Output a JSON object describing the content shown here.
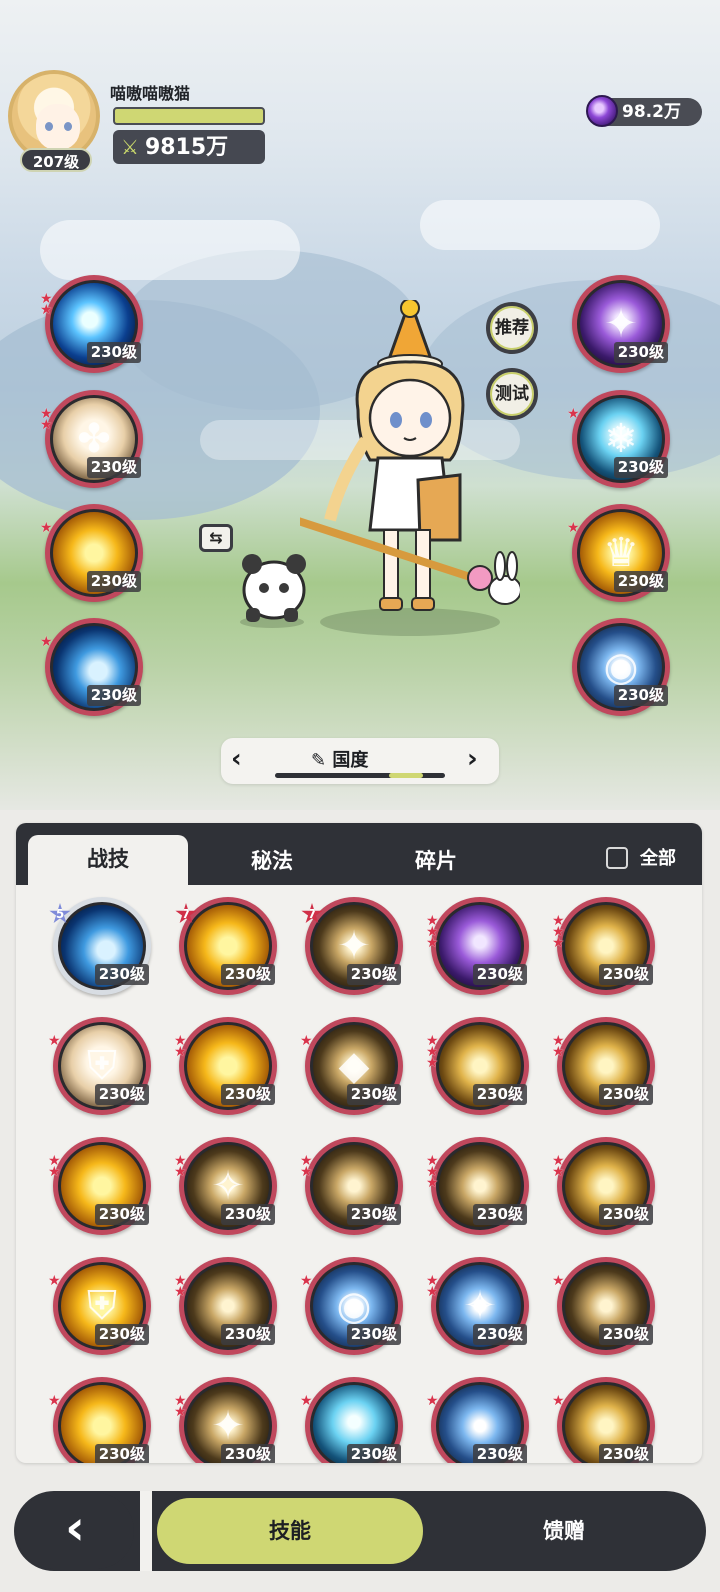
{
  "player": {
    "name": "喵嗷喵嗷猫",
    "level": "207级",
    "power": "9815万"
  },
  "currency": {
    "amount": "98.2万",
    "icon": "purple-gem-icon"
  },
  "side_buttons": {
    "recommend": "推荐",
    "test": "测试"
  },
  "left_skills": [
    {
      "level": "230级",
      "stars": 2,
      "art": "blue-burst"
    },
    {
      "level": "230级",
      "stars": 2,
      "art": "cream-emblem"
    },
    {
      "level": "230级",
      "stars": 1,
      "art": "golden-explosion"
    },
    {
      "level": "230级",
      "stars": 1,
      "art": "blue-wave"
    }
  ],
  "right_skills": [
    {
      "level": "230级",
      "stars": 0,
      "art": "purple-fox"
    },
    {
      "level": "230级",
      "stars": 1,
      "art": "ice-snowflake"
    },
    {
      "level": "230级",
      "stars": 1,
      "art": "golden-crown"
    },
    {
      "level": "230级",
      "stars": 0,
      "art": "blue-orb"
    }
  ],
  "selector": {
    "title": "国度",
    "edit_icon": "pencil-icon",
    "page_fraction": 0.2
  },
  "panel": {
    "tabs": [
      "战技",
      "秘法",
      "碎片"
    ],
    "active_tab": "战技",
    "select_all_label": "全部"
  },
  "grid_skills": [
    {
      "level": "230级",
      "badge": "5",
      "badge_color": "blue",
      "stars": 0,
      "art": "blue-wave"
    },
    {
      "level": "230级",
      "badge": "7",
      "badge_color": "red",
      "stars": 0,
      "art": "golden-burst"
    },
    {
      "level": "230级",
      "badge": "7",
      "badge_color": "red",
      "stars": 0,
      "art": "light-star"
    },
    {
      "level": "230级",
      "badge": "",
      "stars": 3,
      "art": "purple-rings"
    },
    {
      "level": "230级",
      "badge": "",
      "stars": 3,
      "art": "gold-sweep"
    },
    {
      "level": "230级",
      "badge": "",
      "stars": 1,
      "art": "shield"
    },
    {
      "level": "230级",
      "badge": "",
      "stars": 2,
      "art": "fire-slash"
    },
    {
      "level": "230级",
      "badge": "",
      "stars": 1,
      "art": "crystal"
    },
    {
      "level": "230级",
      "badge": "",
      "stars": 3,
      "art": "lightning-sword"
    },
    {
      "level": "230级",
      "badge": "",
      "stars": 2,
      "art": "gold-spikes"
    },
    {
      "level": "230级",
      "badge": "",
      "stars": 2,
      "art": "flame-wing"
    },
    {
      "level": "230级",
      "badge": "",
      "stars": 2,
      "art": "sparkle"
    },
    {
      "level": "230级",
      "badge": "",
      "stars": 2,
      "art": "blade"
    },
    {
      "level": "230级",
      "badge": "",
      "stars": 3,
      "art": "dark-flames"
    },
    {
      "level": "230级",
      "badge": "",
      "stars": 2,
      "art": "light-burst"
    },
    {
      "level": "230级",
      "badge": "",
      "stars": 1,
      "art": "gold-shield"
    },
    {
      "level": "230级",
      "badge": "",
      "stars": 2,
      "art": "light-slash"
    },
    {
      "level": "230级",
      "badge": "",
      "stars": 1,
      "art": "blue-orb"
    },
    {
      "level": "230级",
      "badge": "",
      "stars": 2,
      "art": "blue-compass"
    },
    {
      "level": "230级",
      "badge": "",
      "stars": 1,
      "art": "dash"
    },
    {
      "level": "230级",
      "badge": "",
      "stars": 1,
      "art": "gold-flame"
    },
    {
      "level": "230级",
      "badge": "",
      "stars": 2,
      "art": "star-trail"
    },
    {
      "level": "230级",
      "badge": "",
      "stars": 1,
      "art": "ice-shards"
    },
    {
      "level": "230级",
      "badge": "",
      "stars": 1,
      "art": "blue-halo"
    },
    {
      "level": "230级",
      "badge": "",
      "stars": 1,
      "art": "golden-scroll"
    }
  ],
  "bottom_nav": {
    "back_icon": "chevron-left-icon",
    "skill_label": "技能",
    "gift_label": "馈赠"
  },
  "colors": {
    "accent": "#cfd773",
    "dark": "#2f3137",
    "orb_ring": "#c0485d",
    "star": "#d9344c"
  }
}
